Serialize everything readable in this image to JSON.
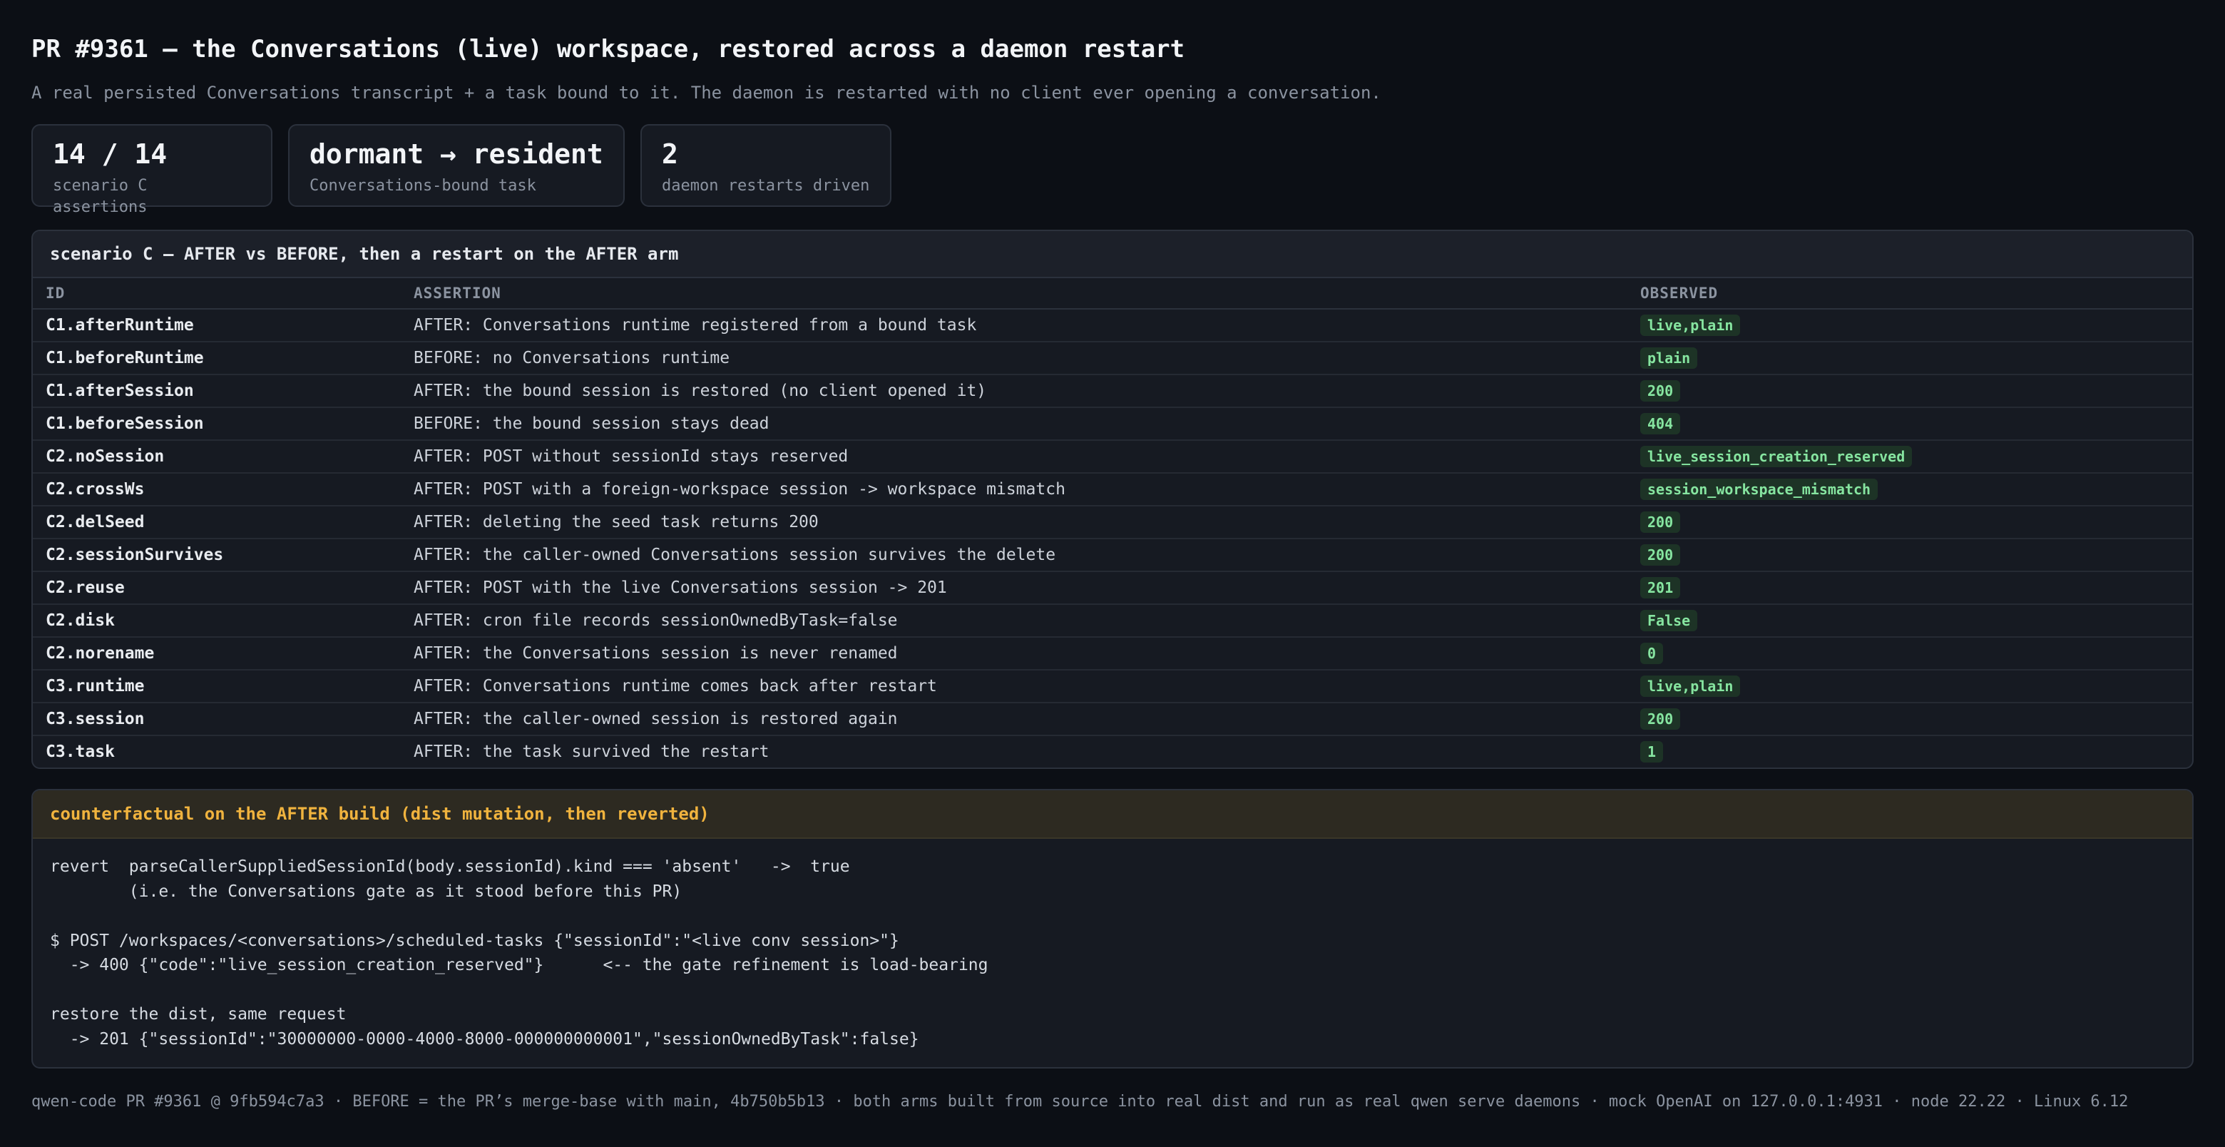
{
  "header": {
    "title": "PR #9361 — the Conversations (live) workspace, restored across a daemon restart",
    "subtitle": "A real persisted Conversations transcript + a task bound to it. The daemon is restarted with no client ever opening a conversation."
  },
  "cards": [
    {
      "value": "14 / 14",
      "label": "scenario C assertions"
    },
    {
      "value": "dormant → resident",
      "label": "Conversations-bound task"
    },
    {
      "value": "2",
      "label": "daemon restarts driven"
    }
  ],
  "scenario": {
    "title": "scenario C — AFTER vs BEFORE, then a restart on the AFTER arm",
    "columns": {
      "id": "ID",
      "assertion": "ASSERTION",
      "observed": "OBSERVED"
    },
    "rows": [
      {
        "id": "C1.afterRuntime",
        "assertion": "AFTER: Conversations runtime registered from a bound task",
        "observed": "live,plain"
      },
      {
        "id": "C1.beforeRuntime",
        "assertion": "BEFORE: no Conversations runtime",
        "observed": "plain"
      },
      {
        "id": "C1.afterSession",
        "assertion": "AFTER: the bound session is restored (no client opened it)",
        "observed": "200"
      },
      {
        "id": "C1.beforeSession",
        "assertion": "BEFORE: the bound session stays dead",
        "observed": "404"
      },
      {
        "id": "C2.noSession",
        "assertion": "AFTER: POST without sessionId stays reserved",
        "observed": "live_session_creation_reserved"
      },
      {
        "id": "C2.crossWs",
        "assertion": "AFTER: POST with a foreign-workspace session -> workspace mismatch",
        "observed": "session_workspace_mismatch"
      },
      {
        "id": "C2.delSeed",
        "assertion": "AFTER: deleting the seed task returns 200",
        "observed": "200"
      },
      {
        "id": "C2.sessionSurvives",
        "assertion": "AFTER: the caller-owned Conversations session survives the delete",
        "observed": "200"
      },
      {
        "id": "C2.reuse",
        "assertion": "AFTER: POST with the live Conversations session -> 201",
        "observed": "201"
      },
      {
        "id": "C2.disk",
        "assertion": "AFTER: cron file records sessionOwnedByTask=false",
        "observed": "False"
      },
      {
        "id": "C2.norename",
        "assertion": "AFTER: the Conversations session is never renamed",
        "observed": "0"
      },
      {
        "id": "C3.runtime",
        "assertion": "AFTER: Conversations runtime comes back after restart",
        "observed": "live,plain"
      },
      {
        "id": "C3.session",
        "assertion": "AFTER: the caller-owned session is restored again",
        "observed": "200"
      },
      {
        "id": "C3.task",
        "assertion": "AFTER: the task survived the restart",
        "observed": "1"
      }
    ]
  },
  "counterfactual": {
    "title": "counterfactual on the AFTER build (dist mutation, then reverted)",
    "lines": [
      "revert  parseCallerSuppliedSessionId(body.sessionId).kind === 'absent'   ->  true",
      "        (i.e. the Conversations gate as it stood before this PR)",
      "",
      "$ POST /workspaces/<conversations>/scheduled-tasks {\"sessionId\":\"<live conv session>\"}",
      "  -> 400 {\"code\":\"live_session_creation_reserved\"}      <-- the gate refinement is load-bearing",
      "",
      "restore the dist, same request",
      "  -> 201 {\"sessionId\":\"30000000-0000-4000-8000-000000000001\",\"sessionOwnedByTask\":false}"
    ]
  },
  "footer": "qwen-code PR #9361 @ 9fb594c7a3 · BEFORE = the PR’s merge-base with main, 4b750b5b13 · both arms built from source into real dist and run as real qwen serve daemons · mock OpenAI on 127.0.0.1:4931 · node 22.22 · Linux 6.12"
}
